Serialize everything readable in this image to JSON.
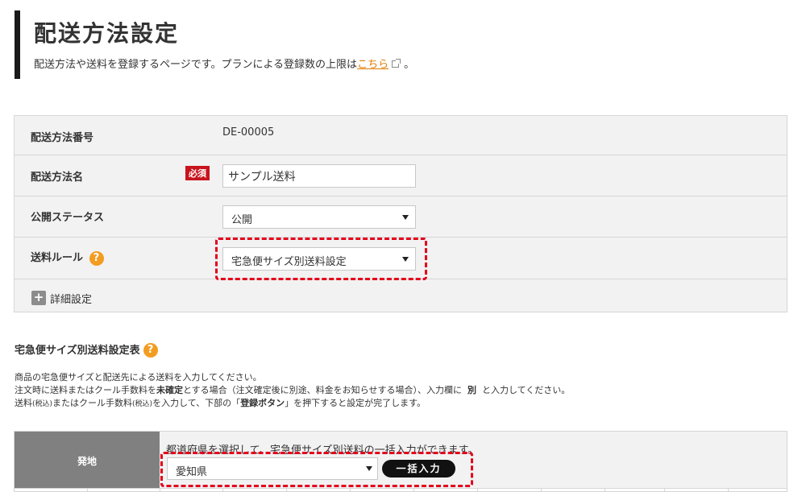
{
  "header": {
    "title": "配送方法設定",
    "description_before_link": "配送方法や送料を登録するページです。プランによる登録数の上限は",
    "link_text": "こちら",
    "description_after_link": "。"
  },
  "form": {
    "method_number": {
      "label": "配送方法番号",
      "value": "DE-00005"
    },
    "method_name": {
      "label": "配送方法名",
      "required_badge": "必須",
      "value": "サンプル送料"
    },
    "publish_status": {
      "label": "公開ステータス",
      "selected": "公開"
    },
    "shipping_rule": {
      "label": "送料ルール",
      "help": "?",
      "selected": "宅急便サイズ別送料設定"
    },
    "detail": {
      "plus": "+",
      "label": "詳細設定"
    }
  },
  "section": {
    "title": "宅急便サイズ別送料設定表",
    "help": "?",
    "line1": "商品の宅急便サイズと配送先による送料を入力してください。",
    "line2_a": "注文時に送料またはクール手数料を",
    "line2_bold": "未確定",
    "line2_b": "とする場合（注文確定後に別途、料金をお知らせする場合）、入力欄に",
    "line2_bold2": "別",
    "line2_c": "と入力してください。",
    "line3_a": "送料",
    "line3_small1": "(税込)",
    "line3_b": "またはクール手数料",
    "line3_small2": "(税込)",
    "line3_c": "を入力して、下部の「",
    "line3_bold": "登録ボタン",
    "line3_d": "」を押下すると設定が完了します。"
  },
  "table": {
    "origin_header": "発地",
    "bulk_note": "都道府県を選択して、宅急便サイズ別送料の一括入力ができます。",
    "prefecture_selected": "愛知県",
    "bulk_button": "一括入力"
  },
  "colors": {
    "accent_orange": "#f39c1f",
    "required_red": "#c8141e",
    "highlight_dash": "#e4001b",
    "link": "#e07b00"
  }
}
